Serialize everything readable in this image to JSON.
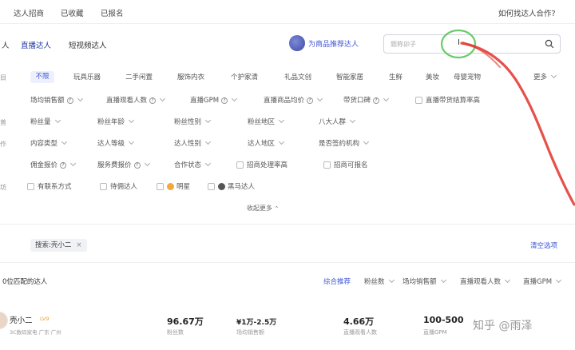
{
  "topnav": {
    "tabs": [
      "达人招商",
      "已收藏",
      "已报名"
    ],
    "help_link": "如何找达人合作?"
  },
  "subtabs": {
    "items": [
      "直播达人",
      "短视频达人"
    ],
    "active": "直播达人",
    "left_fragment": "人",
    "recommend_label": "为商品推荐达人"
  },
  "search": {
    "placeholder": "题称卯子",
    "cursor_glyph": "I"
  },
  "category_filters": {
    "selected": "不限",
    "items": [
      "玩具乐器",
      "二手闲置",
      "服饰内衣",
      "个护家清",
      "礼品文创",
      "智能家居",
      "生鲜",
      "美妆",
      "母婴宠物"
    ],
    "more_label": "更多"
  },
  "row_markers": [
    "目",
    "",
    "普",
    "",
    "作",
    "",
    "坊"
  ],
  "filter_rows": {
    "row2": [
      "场均销售额",
      "直播观看人数",
      "直播GPM",
      "直播商品均价",
      "带货口碑",
      "直播带货结算率高"
    ],
    "row3": [
      "粉丝量",
      "粉丝年龄",
      "粉丝性别",
      "粉丝地区",
      "八大人群"
    ],
    "row4": [
      "内容类型",
      "达人等级",
      "达人性别",
      "达人地区",
      "是否签约机构"
    ],
    "row5": [
      "佣金报价",
      "服务费报价",
      "合作状态",
      "招商处理率高",
      "招商可报名"
    ],
    "row6": [
      "有联系方式",
      "待佣达人",
      "明星",
      "黑马达人"
    ]
  },
  "collapse_label": "收起更多",
  "search_chip": {
    "label": "搜索:壳小二",
    "close": "×"
  },
  "clear_label": "清空选项",
  "results": {
    "count_text": "0位匹配的达人",
    "sort_options": [
      "综合推荐",
      "粉丝数",
      "场均销售额",
      "直播观看人数",
      "直播GPM"
    ],
    "active_sort": "综合推荐"
  },
  "creator": {
    "name": "壳小二",
    "badge": "LV9",
    "subline": "3C数码家电 广东·广州",
    "stats": [
      {
        "value": "96.67万",
        "label": "粉丝数"
      },
      {
        "value": "¥1万-2.5万",
        "label": "场均销售额"
      },
      {
        "value": "4.66万",
        "label": "直播观看人数"
      },
      {
        "value": "100-500",
        "label": "直播GPM"
      }
    ]
  },
  "watermark": "知乎 @雨泽",
  "colors": {
    "accent": "#3d56d8",
    "annotation_red": "#e0322b",
    "annotation_green": "#4fc24f"
  },
  "icons": [
    "search-icon",
    "chevron-down-icon",
    "help-circle-icon",
    "close-icon",
    "avatar",
    "recommend-icon"
  ]
}
